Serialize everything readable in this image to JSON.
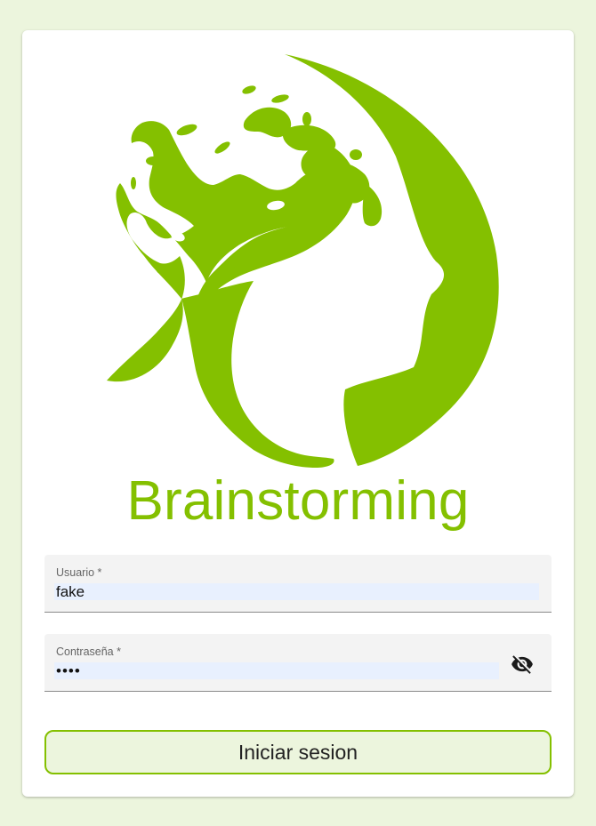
{
  "brand": {
    "name": "Brainstorming",
    "color": "#84c000"
  },
  "form": {
    "username": {
      "label": "Usuario *",
      "value": "fake"
    },
    "password": {
      "label": "Contraseña *",
      "value": "••••",
      "toggle_icon": "eye-off-icon"
    },
    "submit_label": "Iniciar sesion"
  },
  "logo": {
    "icon": "brain-tree-head-logo"
  }
}
